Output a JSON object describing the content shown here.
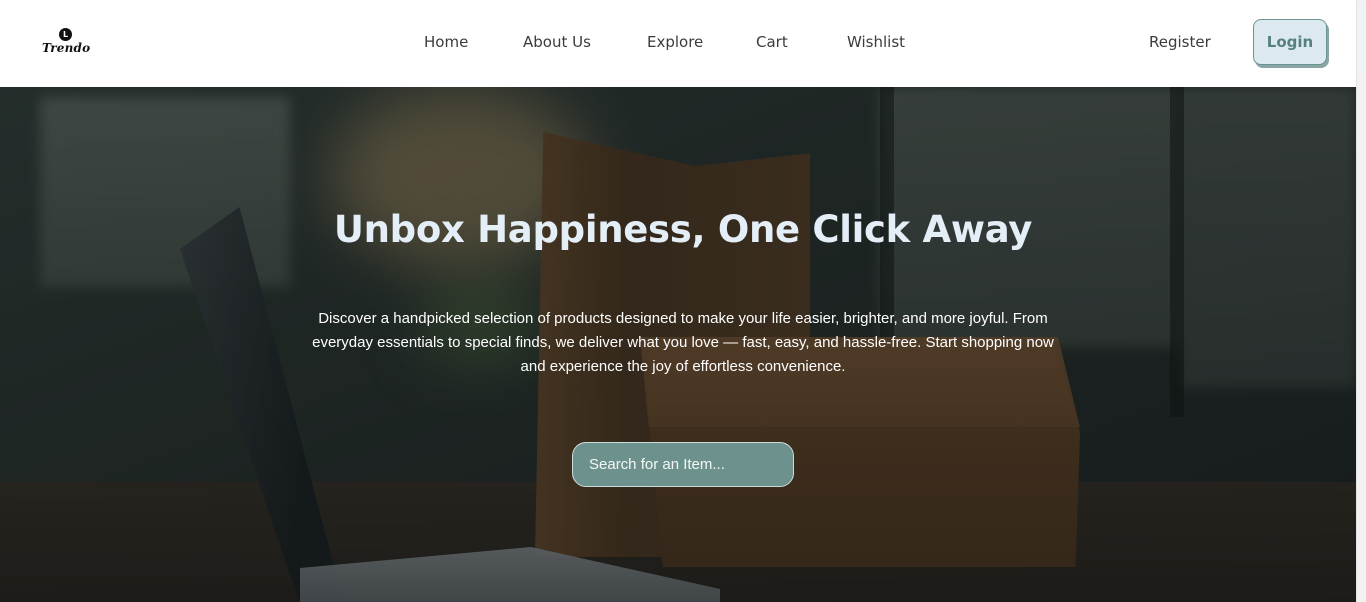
{
  "brand": {
    "name": "Trendo",
    "mark": "L"
  },
  "nav": {
    "items": [
      {
        "label": "Home"
      },
      {
        "label": "About Us"
      },
      {
        "label": "Explore"
      },
      {
        "label": "Cart"
      },
      {
        "label": "Wishlist"
      }
    ]
  },
  "auth": {
    "register_label": "Register",
    "login_label": "Login"
  },
  "hero": {
    "title": "Unbox Happiness, One Click Away",
    "description": "Discover a handpicked selection of products designed to make your life easier, brighter, and more joyful. From everyday essentials to special finds, we deliver what you love — fast, easy, and hassle-free. Start shopping now and experience the joy of effortless convenience.",
    "search_placeholder": "Search for an Item..."
  },
  "colors": {
    "header_bg": "#ffffff",
    "login_bg": "#dce9ef",
    "login_text": "#55807f",
    "search_bg": "#6d918c",
    "title_color": "#e4eef6"
  }
}
